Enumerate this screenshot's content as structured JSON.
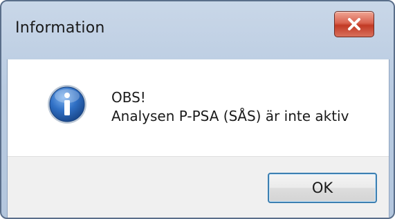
{
  "window": {
    "title": "Information"
  },
  "message": {
    "line1": "OBS!",
    "line2": "Analysen P-PSA (SÅS) är inte aktiv"
  },
  "buttons": {
    "ok_label": "OK"
  },
  "icons": {
    "close": "close-icon",
    "info": "information-icon"
  },
  "colors": {
    "title_bar": "#c9d7e8",
    "close_button": "#c23a25",
    "ok_border": "#3c7fb1",
    "info_icon": "#2f6fc4"
  }
}
